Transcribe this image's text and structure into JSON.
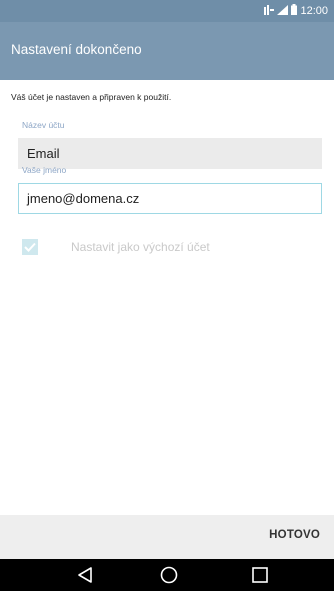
{
  "status_bar": {
    "time": "12:00",
    "icons": [
      "network-type-icon",
      "signal-icon",
      "battery-icon"
    ]
  },
  "app_bar": {
    "title": "Nastavení dokončeno"
  },
  "content": {
    "description": "Váš účet je nastaven a připraven k použití.",
    "account_name": {
      "label": "Název účtu",
      "value": "Email"
    },
    "your_name": {
      "label": "Vaše jméno",
      "value": "jmeno@domena.cz"
    },
    "default_account": {
      "label": "Nastavit jako výchozí účet",
      "checked": true
    }
  },
  "action_bar": {
    "done_label": "HOTOVO"
  },
  "nav_bar": {
    "buttons": [
      "back-icon",
      "home-icon",
      "recent-apps-icon"
    ]
  },
  "colors": {
    "status_bar": "#6f8ea8",
    "app_bar": "#7b98b1",
    "label": "#8da6c6",
    "input_focus_border": "#9ed8e4",
    "checkbox": "#cfe8ee"
  }
}
